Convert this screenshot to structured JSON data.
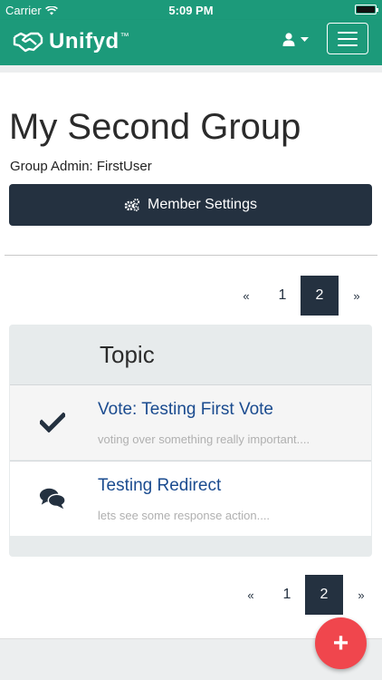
{
  "status": {
    "carrier": "Carrier",
    "time": "5:09 PM"
  },
  "nav": {
    "brand": "Unifyd",
    "trademark": "™"
  },
  "group": {
    "title": "My Second Group",
    "admin": "Group Admin: FirstUser",
    "member_settings_label": "Member Settings"
  },
  "pagination_top": {
    "prev": "«",
    "pages": [
      "1",
      "2"
    ],
    "active": "2",
    "next": "»"
  },
  "topics": {
    "header": "Topic",
    "items": [
      {
        "title": "Vote: Testing First Vote",
        "description": "voting over something really important....",
        "icon": "checkmark-icon"
      },
      {
        "title": "Testing Redirect",
        "description": "lets see some response action....",
        "icon": "comments-icon"
      }
    ]
  },
  "pagination_bottom": {
    "prev": "«",
    "pages": [
      "1",
      "2"
    ],
    "active": "2",
    "next": "»"
  },
  "fab": {
    "label": "+"
  },
  "colors": {
    "brand": "#1c9a7a",
    "dark": "#243140",
    "link": "#1a4b8f",
    "fab": "#f0464d"
  }
}
